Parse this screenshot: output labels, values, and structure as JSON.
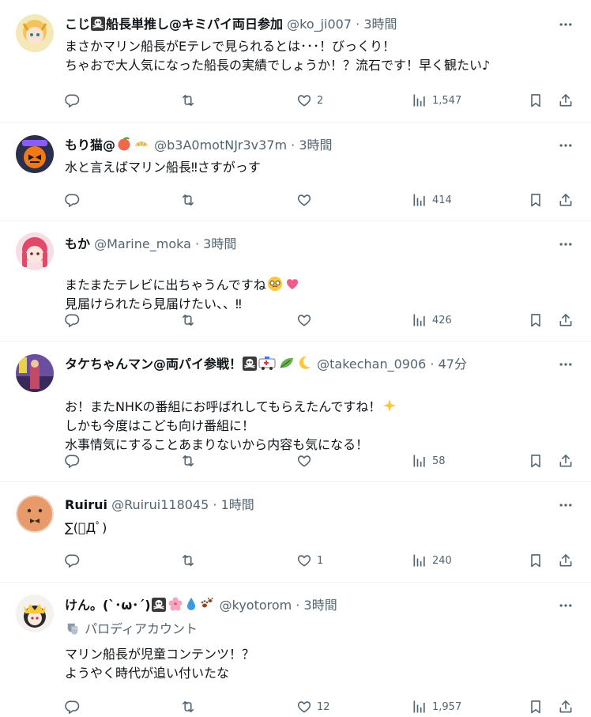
{
  "tweets": [
    {
      "name": "こじ",
      "name_suffix": "船長単推し@キミパイ両日参加",
      "handle": "@ko_ji007",
      "time": "3時間",
      "text": "まさかマリン船長がEテレで見られるとは･･･！びっくり！\nちゃおで大人気になった船長の実績でしょうか！？流石です！早く観たい♪",
      "likes": "2",
      "views": "1,547"
    },
    {
      "name": "もり猫@",
      "handle": "@b3A0motNJr3v37m",
      "time": "3時間",
      "text": "水と言えばマリン船長‼さすがっす",
      "likes": "",
      "views": "414"
    },
    {
      "name": "もか",
      "handle": "@Marine_moka",
      "time": "3時間",
      "text": "またまたテレビに出ちゃうんですね",
      "text2": "見届けられたら見届けたい、、‼",
      "likes": "",
      "views": "426"
    },
    {
      "name": "タケちゃんマン@両パイ参戦！",
      "handle": "@takechan_0906",
      "time": "47分",
      "text": "お！またNHKの番組にお呼ばれしてもらえたんですね！",
      "text2": "しかも今度はこども向け番組に！\n水事情気にすることあまりないから内容も気になる！",
      "likes": "",
      "views": "58"
    },
    {
      "name": "Ruirui",
      "handle": "@Ruirui118045",
      "time": "1時間",
      "text": "∑(ﾟДﾟ)",
      "likes": "1",
      "views": "240"
    },
    {
      "name": "けん。(`･ω･´)",
      "handle": "@kyotorom",
      "time": "3時間",
      "parody_label": "パロディアカウント",
      "text": "マリン船長が児童コンテンツ！？\nようやく時代が追い付いたな",
      "likes": "12",
      "views": "1,957"
    }
  ],
  "separator": "·",
  "colors": {
    "text": "#0f1419",
    "muted": "#536471",
    "border": "#eff3f4",
    "heart": "#f91880"
  }
}
